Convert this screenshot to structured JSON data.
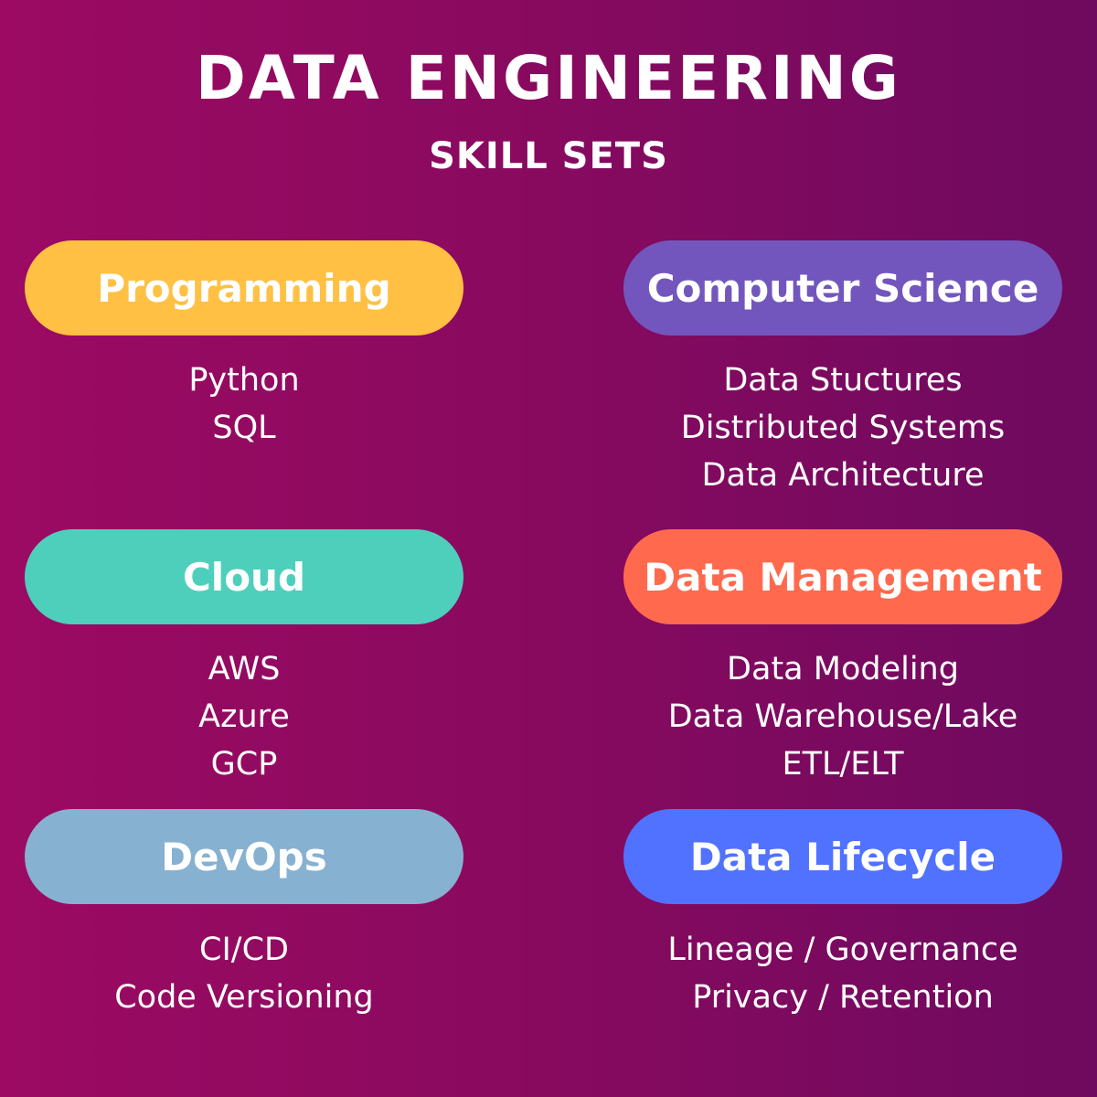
{
  "header": {
    "title": "DATA ENGINEERING",
    "subtitle": "SKILL SETS"
  },
  "categories": [
    {
      "label": "Programming",
      "color": "#ffc044",
      "items": [
        "Python",
        "SQL"
      ]
    },
    {
      "label": "Computer Science",
      "color": "#7356bd",
      "items": [
        "Data Stuctures",
        "Distributed Systems",
        "Data Architecture"
      ]
    },
    {
      "label": "Cloud",
      "color": "#4ecfbb",
      "items": [
        "AWS",
        "Azure",
        "GCP"
      ]
    },
    {
      "label": "Data Management",
      "color": "#ff6a4e",
      "items": [
        "Data Modeling",
        "Data Warehouse/Lake",
        "ETL/ELT"
      ]
    },
    {
      "label": "DevOps",
      "color": "#87b1d0",
      "items": [
        "CI/CD",
        "Code Versioning"
      ]
    },
    {
      "label": "Data Lifecycle",
      "color": "#5172ff",
      "items": [
        "Lineage / Governance",
        "Privacy / Retention"
      ]
    }
  ]
}
